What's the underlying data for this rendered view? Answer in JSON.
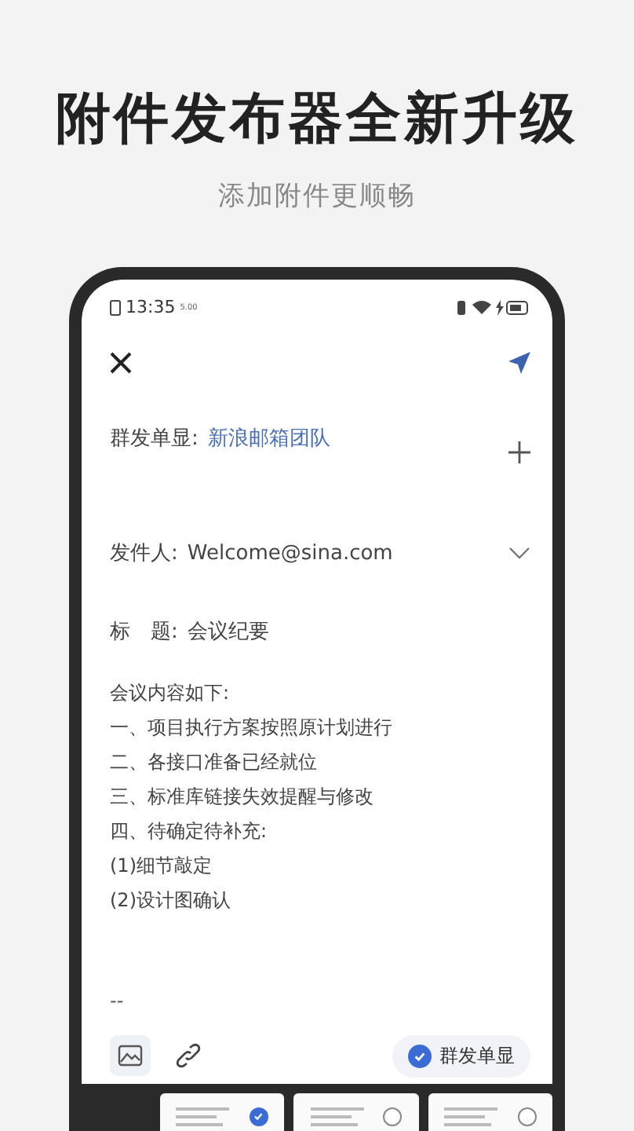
{
  "headline": "附件发布器全新升级",
  "subheadline": "添加附件更顺畅",
  "status_bar": {
    "time": "13:35",
    "speed": "5.00"
  },
  "compose": {
    "group_send": {
      "label": "群发单显:",
      "value": "新浪邮箱团队"
    },
    "sender": {
      "label": "发件人:",
      "value": "Welcome@sina.com"
    },
    "subject": {
      "label": "标　题:",
      "value": "会议纪要"
    },
    "body": [
      "会议内容如下:",
      "一、项目执行方案按照原计划进行",
      "二、各接口准备已经就位",
      "三、标准库链接失效提醒与修改",
      "四、待确定待补充:",
      "(1)细节敲定",
      "(2)设计图确认"
    ],
    "signature": "--"
  },
  "toolbar": {
    "group_send_toggle": {
      "label": "群发单显",
      "checked": true
    }
  },
  "attachments": [
    {
      "checked": true
    },
    {
      "checked": false
    },
    {
      "checked": false
    }
  ]
}
